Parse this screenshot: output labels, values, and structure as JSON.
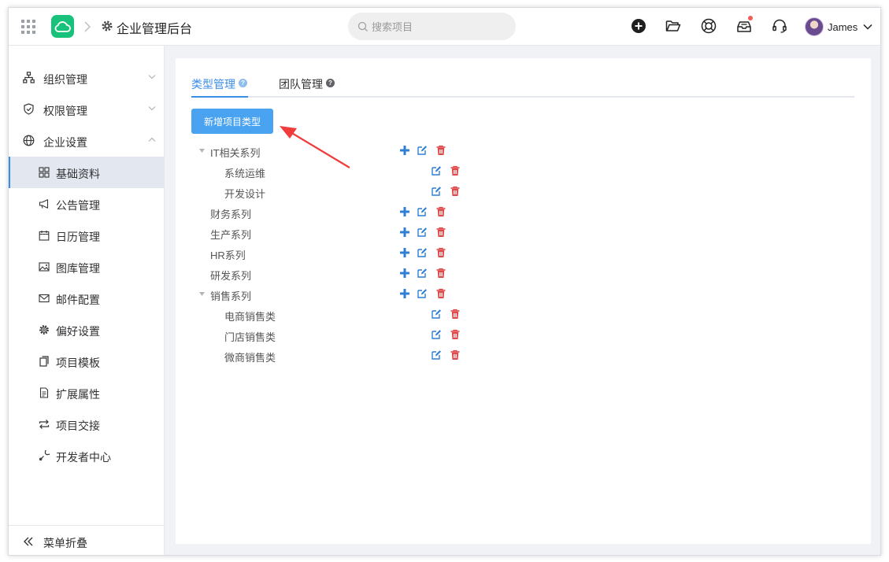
{
  "header": {
    "app_title": "企业管理后台",
    "search_placeholder": "搜索项目",
    "user_name": "James",
    "icons": [
      "apps-grid-icon",
      "cloud-logo-icon",
      "gear-icon",
      "add-circle-icon",
      "folder-open-icon",
      "help-lifebuoy-icon",
      "inbox-icon",
      "headset-icon"
    ],
    "notification_dot_color": "#f25c54"
  },
  "sidebar": {
    "groups": [
      {
        "label": "组织管理",
        "icon": "org-chart-icon",
        "expanded": false
      },
      {
        "label": "权限管理",
        "icon": "shield-icon",
        "expanded": false
      },
      {
        "label": "企业设置",
        "icon": "globe-icon",
        "expanded": true
      }
    ],
    "items": [
      {
        "label": "基础资料",
        "icon": "grid-icon",
        "active": true
      },
      {
        "label": "公告管理",
        "icon": "megaphone-icon",
        "active": false
      },
      {
        "label": "日历管理",
        "icon": "calendar-icon",
        "active": false
      },
      {
        "label": "图库管理",
        "icon": "image-icon",
        "active": false
      },
      {
        "label": "邮件配置",
        "icon": "mail-icon",
        "active": false
      },
      {
        "label": "偏好设置",
        "icon": "settings-icon",
        "active": false
      },
      {
        "label": "项目模板",
        "icon": "copy-icon",
        "active": false
      },
      {
        "label": "扩展属性",
        "icon": "document-icon",
        "active": false
      },
      {
        "label": "项目交接",
        "icon": "swap-icon",
        "active": false
      },
      {
        "label": "开发者中心",
        "icon": "tool-icon",
        "active": false
      }
    ],
    "collapse_label": "菜单折叠"
  },
  "main": {
    "tabs": [
      {
        "label": "类型管理",
        "active": true
      },
      {
        "label": "团队管理",
        "active": false
      }
    ],
    "add_button_label": "新增项目类型",
    "accent_color": "#3a8ee6",
    "tree": [
      {
        "label": "IT相关系列",
        "level": 1,
        "expanded": true,
        "can_add": true
      },
      {
        "label": "系统运维",
        "level": 2,
        "can_add": false
      },
      {
        "label": "开发设计",
        "level": 2,
        "can_add": false
      },
      {
        "label": "财务系列",
        "level": 1,
        "can_add": true
      },
      {
        "label": "生产系列",
        "level": 1,
        "can_add": true
      },
      {
        "label": "HR系列",
        "level": 1,
        "can_add": true
      },
      {
        "label": "研发系列",
        "level": 1,
        "can_add": true
      },
      {
        "label": "销售系列",
        "level": 1,
        "expanded": true,
        "can_add": true
      },
      {
        "label": "电商销售类",
        "level": 2,
        "can_add": false
      },
      {
        "label": "门店销售类",
        "level": 2,
        "can_add": false
      },
      {
        "label": "微商销售类",
        "level": 2,
        "can_add": false
      }
    ]
  }
}
